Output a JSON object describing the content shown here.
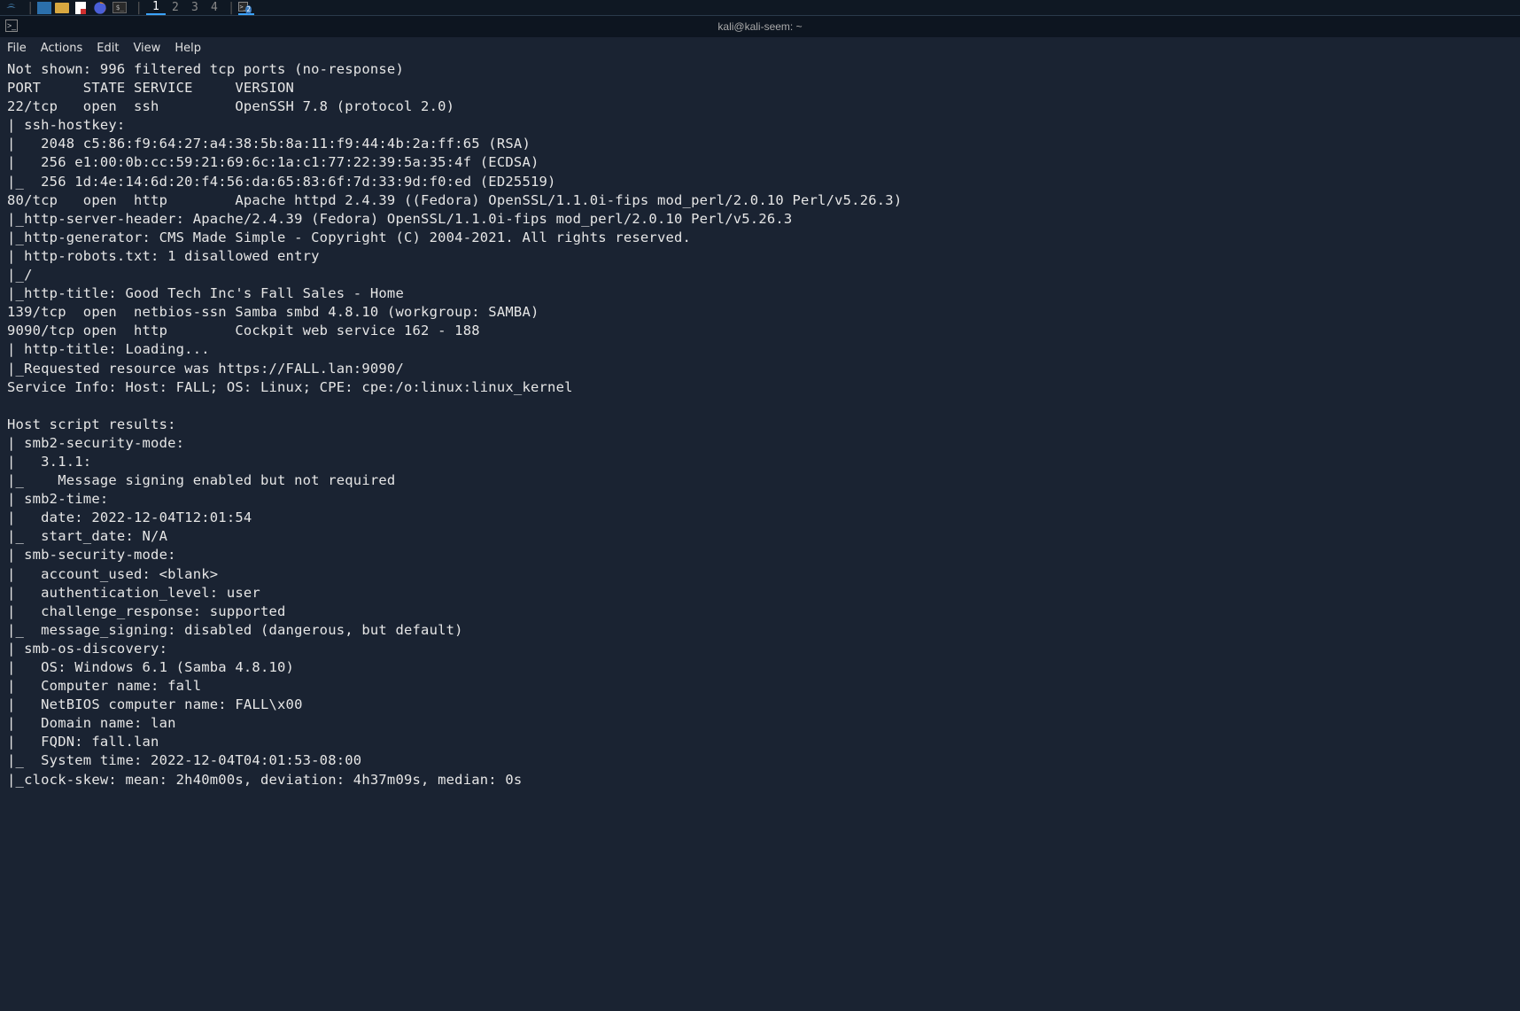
{
  "taskbar": {
    "workspaces": [
      "1",
      "2",
      "3",
      "4"
    ]
  },
  "titlebar": {
    "title": "kali@kali-seem: ~"
  },
  "menubar": {
    "file": "File",
    "actions": "Actions",
    "edit": "Edit",
    "view": "View",
    "help": "Help"
  },
  "terminal_lines": [
    "Not shown: 996 filtered tcp ports (no-response)",
    "PORT     STATE SERVICE     VERSION",
    "22/tcp   open  ssh         OpenSSH 7.8 (protocol 2.0)",
    "| ssh-hostkey: ",
    "|   2048 c5:86:f9:64:27:a4:38:5b:8a:11:f9:44:4b:2a:ff:65 (RSA)",
    "|   256 e1:00:0b:cc:59:21:69:6c:1a:c1:77:22:39:5a:35:4f (ECDSA)",
    "|_  256 1d:4e:14:6d:20:f4:56:da:65:83:6f:7d:33:9d:f0:ed (ED25519)",
    "80/tcp   open  http        Apache httpd 2.4.39 ((Fedora) OpenSSL/1.1.0i-fips mod_perl/2.0.10 Perl/v5.26.3)",
    "|_http-server-header: Apache/2.4.39 (Fedora) OpenSSL/1.1.0i-fips mod_perl/2.0.10 Perl/v5.26.3",
    "|_http-generator: CMS Made Simple - Copyright (C) 2004-2021. All rights reserved.",
    "| http-robots.txt: 1 disallowed entry ",
    "|_/",
    "|_http-title: Good Tech Inc's Fall Sales - Home",
    "139/tcp  open  netbios-ssn Samba smbd 4.8.10 (workgroup: SAMBA)",
    "9090/tcp open  http        Cockpit web service 162 - 188",
    "| http-title: Loading...",
    "|_Requested resource was https://FALL.lan:9090/",
    "Service Info: Host: FALL; OS: Linux; CPE: cpe:/o:linux:linux_kernel",
    "",
    "Host script results:",
    "| smb2-security-mode: ",
    "|   3.1.1: ",
    "|_    Message signing enabled but not required",
    "| smb2-time: ",
    "|   date: 2022-12-04T12:01:54",
    "|_  start_date: N/A",
    "| smb-security-mode: ",
    "|   account_used: <blank>",
    "|   authentication_level: user",
    "|   challenge_response: supported",
    "|_  message_signing: disabled (dangerous, but default)",
    "| smb-os-discovery: ",
    "|   OS: Windows 6.1 (Samba 4.8.10)",
    "|   Computer name: fall",
    "|   NetBIOS computer name: FALL\\x00",
    "|   Domain name: lan",
    "|   FQDN: fall.lan",
    "|_  System time: 2022-12-04T04:01:53-08:00",
    "|_clock-skew: mean: 2h40m00s, deviation: 4h37m09s, median: 0s"
  ]
}
